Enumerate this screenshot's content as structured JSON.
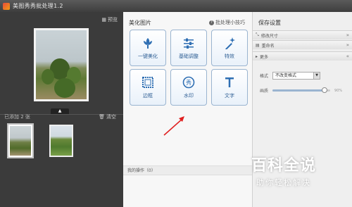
{
  "window": {
    "title": "美图秀秀批处理1.2"
  },
  "left_panel": {
    "preview_label": "预览",
    "added_count": "已添加 2 张",
    "clear_label": "清空"
  },
  "center_panel": {
    "title": "美化图片",
    "tips_label": "批处理小技巧",
    "tools": [
      {
        "label": "一键美化",
        "icon": "flower-icon"
      },
      {
        "label": "基础调整",
        "icon": "sliders-icon"
      },
      {
        "label": "特效",
        "icon": "magic-wand-icon"
      },
      {
        "label": "边框",
        "icon": "frame-icon"
      },
      {
        "label": "水印",
        "icon": "watermark-icon"
      },
      {
        "label": "文字",
        "icon": "text-icon"
      }
    ],
    "ops_label": "我的操作（0）"
  },
  "right_panel": {
    "title": "保存设置",
    "sections": [
      {
        "label": "修改尺寸"
      },
      {
        "label": "重命名"
      },
      {
        "label": "更多"
      }
    ],
    "format_label": "格式",
    "format_value": "不改变格式",
    "quality_label": "画质",
    "quality_value": "90%",
    "quality_fraction": 0.9
  },
  "overlay_watermark": {
    "main": "百科全说",
    "sub": "助你轻松解决"
  },
  "colors": {
    "accent_blue": "#2f5f95",
    "tool_border": "#9ab4d0",
    "arrow_red": "#e02020"
  }
}
